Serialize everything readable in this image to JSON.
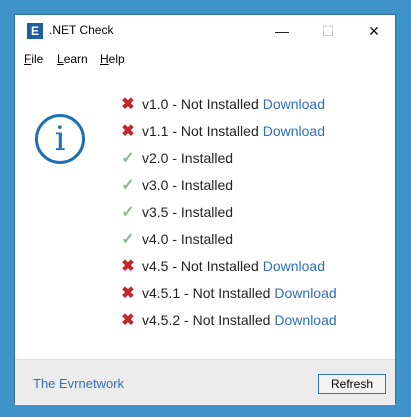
{
  "window": {
    "title": ".NET Check",
    "icon_letter": "E",
    "controls": {
      "minimize": "—",
      "maximize": "☐",
      "close": "✕"
    }
  },
  "menu": [
    {
      "mnemonic": "F",
      "rest": "ile"
    },
    {
      "mnemonic": "L",
      "rest": "earn"
    },
    {
      "mnemonic": "H",
      "rest": "elp"
    }
  ],
  "info_icon_glyph": "i",
  "versions": [
    {
      "status": "x",
      "icon": "✖",
      "text": "v1.0 - Not Installed",
      "link": "Download"
    },
    {
      "status": "x",
      "icon": "✖",
      "text": "v1.1 - Not Installed",
      "link": "Download"
    },
    {
      "status": "ok",
      "icon": "✓",
      "text": "v2.0 - Installed",
      "link": ""
    },
    {
      "status": "ok",
      "icon": "✓",
      "text": "v3.0 - Installed",
      "link": ""
    },
    {
      "status": "ok",
      "icon": "✓",
      "text": "v3.5 - Installed",
      "link": ""
    },
    {
      "status": "ok",
      "icon": "✓",
      "text": "v4.0 - Installed",
      "link": ""
    },
    {
      "status": "x",
      "icon": "✖",
      "text": "v4.5 - Not Installed",
      "link": "Download"
    },
    {
      "status": "x",
      "icon": "✖",
      "text": "v4.5.1 - Not Installed",
      "link": "Download"
    },
    {
      "status": "x",
      "icon": "✖",
      "text": "v4.5.2 - Not Installed",
      "link": "Download"
    }
  ],
  "footer": {
    "link": "The Evrnetwork",
    "refresh_label": "Refresh"
  },
  "colors": {
    "desktop": "#3f93c8",
    "accent": "#1f6fb5",
    "link": "#2e6fbe",
    "not_installed": "#c1272d",
    "installed": "#8fb88f"
  }
}
